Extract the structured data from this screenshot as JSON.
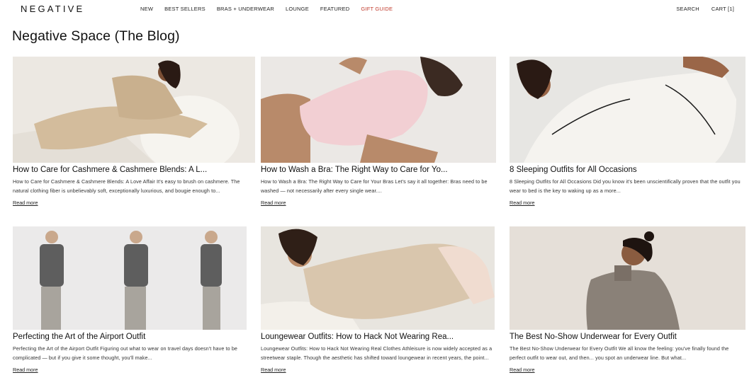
{
  "header": {
    "logo": "NEGATIVE",
    "nav": [
      {
        "label": "NEW"
      },
      {
        "label": "BEST SELLERS"
      },
      {
        "label": "BRAS + UNDERWEAR"
      },
      {
        "label": "LOUNGE"
      },
      {
        "label": "FEATURED"
      },
      {
        "label": "GIFT GUIDE"
      }
    ],
    "search_label": "SEARCH",
    "cart_label": "CART [1]",
    "accent_color": "#c0392b"
  },
  "page": {
    "title": "Negative Space (The Blog)"
  },
  "posts": [
    {
      "title": "How to Care for Cashmere & Cashmere Blends: A L...",
      "excerpt": "How to Care for Cashmere & Cashmere Blends: A Love Affair It's easy to brush on cashmere. The natural clothing fiber is unbelievably soft, exceptionally luxurious, and bougie enough to...",
      "read_more": "Read more"
    },
    {
      "title": "How to Wash a Bra: The Right Way to Care for Yo...",
      "excerpt": "How to Wash a Bra: The Right Way to Care for Your Bras Let's say it all together: Bras need to be washed — not necessarily after every single wear....",
      "read_more": "Read more"
    },
    {
      "title": "8 Sleeping Outfits for All Occasions",
      "excerpt": "8 Sleeping Outfits for All Occasions Did you know it's been unscientifically proven that the outfit you wear to bed is the key to waking up as a more...",
      "read_more": "Read more"
    },
    {
      "title": "Perfecting the Art of the Airport Outfit",
      "excerpt": "Perfecting the Art of the Airport Outfit Figuring out what to wear on travel days doesn't have to be complicated — but if you give it some thought, you'll make...",
      "read_more": "Read more"
    },
    {
      "title": "Loungewear Outfits: How to Hack Not Wearing Rea...",
      "excerpt": "Loungewear Outfits: How to Hack Not Wearing Real Clothes Athleisure is now widely accepted as a streetwear staple. Though the aesthetic has shifted toward loungewear in recent years, the point...",
      "read_more": "Read more"
    },
    {
      "title": "The Best No-Show Underwear for Every Outfit",
      "excerpt": "The Best No-Show Underwear for Every Outfit We all know the feeling: you've finally found the perfect outfit to wear out, and then... you spot an underwear line. But what...",
      "read_more": "Read more"
    }
  ]
}
